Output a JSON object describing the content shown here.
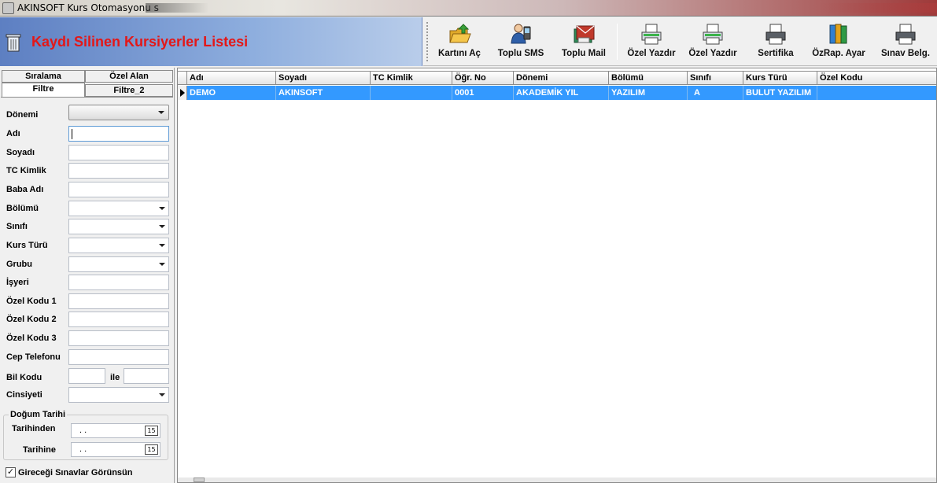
{
  "window": {
    "title": "AKINSOFT Kurs Otomasyonu s"
  },
  "header": {
    "title": "Kaydı Silinen Kursiyerler Listesi"
  },
  "toolbar": {
    "buttons": [
      {
        "label": "Kartını Aç",
        "icon": "folder-open-icon"
      },
      {
        "label": "Toplu SMS",
        "icon": "person-phone-icon"
      },
      {
        "label": "Toplu Mail",
        "icon": "books-mail-icon"
      },
      {
        "label": "Özel Yazdır",
        "icon": "printer-icon"
      },
      {
        "label": "Özel Yazdır",
        "icon": "printer-icon"
      },
      {
        "label": "Sertifika",
        "icon": "printer-icon"
      },
      {
        "label": "ÖzRap. Ayar",
        "icon": "books-icon"
      },
      {
        "label": "Sınav Belg.",
        "icon": "printer-icon"
      }
    ]
  },
  "tabs": {
    "siralama": "Sıralama",
    "ozel_alan": "Özel Alan",
    "filtre": "Filtre",
    "filtre2": "Filtre_2"
  },
  "filter": {
    "donemi": "Dönemi",
    "adi": "Adı",
    "soyadi": "Soyadı",
    "tc_kimlik": "TC Kimlik",
    "baba_adi": "Baba Adı",
    "bolumu": "Bölümü",
    "sinifi": "Sınıfı",
    "kurs_turu": "Kurs Türü",
    "grubu": "Grubu",
    "isyeri": "İşyeri",
    "ozel_kodu_1": "Özel Kodu 1",
    "ozel_kodu_2": "Özel Kodu 2",
    "ozel_kodu_3": "Özel Kodu 3",
    "cep_telefonu": "Cep Telefonu",
    "bil_kodu": "Bil Kodu",
    "ile": "ile",
    "cinsiyeti": "Cinsiyeti",
    "dogum_tarihi": "Doğum Tarihi",
    "tarihinden": "Tarihinden",
    "tarihine": "Tarihine",
    "date_placeholder": ". .",
    "cal_label": "15",
    "gireceği_label": "Gireceği Sınavlar Görünsün",
    "gireceği_checked": "✓"
  },
  "grid": {
    "columns": [
      "Adı",
      "Soyadı",
      "TC Kimlik",
      "Öğr. No",
      "Dönemi",
      "Bölümü",
      "Sınıfı",
      "Kurs Türü",
      "Özel Kodu"
    ],
    "rows": [
      [
        "DEMO",
        "AKINSOFT",
        "",
        "0001",
        "AKADEMİK YIL",
        "YAZILIM",
        "A",
        "BULUT YAZILIM",
        ""
      ]
    ],
    "selected_color": "#3399ff"
  },
  "colors": {
    "title_red": "#e41717",
    "header_blue": "#5d7fc2"
  }
}
